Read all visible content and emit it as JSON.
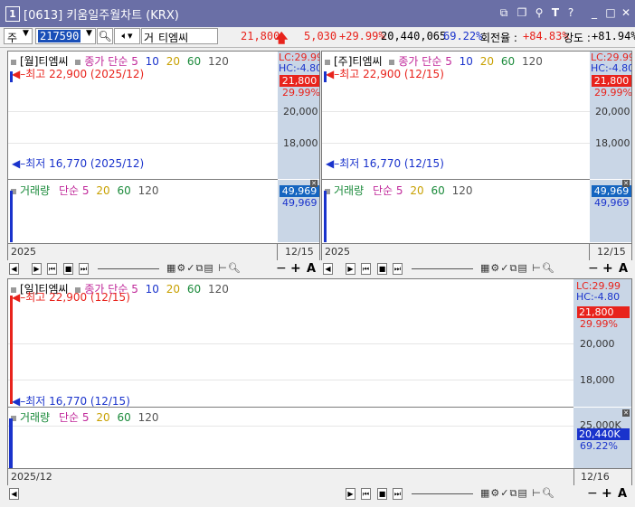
{
  "window": {
    "badge": "1",
    "title": "[0613] 키움일주월차트 (KRX)"
  },
  "toolbar": {
    "period_type": "주",
    "code": "217590",
    "market_flag": "거",
    "stock_name": "티엠씨",
    "price": "21,800",
    "change": "5,030",
    "change_pct": "+29.99%",
    "volume": "20,440,065",
    "volume_ratio": "69.22%",
    "turnover_label": "회전율 :",
    "turnover_value": "+84.83%",
    "strength_label": "강도 :",
    "strength_value": "+81.94%"
  },
  "panel_month": {
    "legend_title": "[월]티엠씨",
    "legend_price": "종가",
    "legend_ma_label": "단순",
    "ma_periods": [
      "5",
      "10",
      "20",
      "60",
      "120"
    ],
    "high_label": "최고 22,900 (2025/12)",
    "low_label": "최저 16,770 (2025/12)",
    "lc": "LC:29.99",
    "hc": "HC:-4.80",
    "price_badge": "21,800",
    "price_pct": "29.99%",
    "ticks": [
      "20,000",
      "18,000"
    ],
    "vol_legend": "거래량",
    "vol_badge": "49,969",
    "vol_value": "49,969",
    "x_start": "2025",
    "x_end": "12/15"
  },
  "panel_week": {
    "legend_title": "[주]티엠씨",
    "legend_price": "종가",
    "legend_ma_label": "단순",
    "ma_periods": [
      "5",
      "10",
      "20",
      "60",
      "120"
    ],
    "high_label": "최고 22,900 (12/15)",
    "low_label": "최저 16,770 (12/15)",
    "lc": "LC:29.99",
    "hc": "HC:-4.80",
    "price_badge": "21,800",
    "price_pct": "29.99%",
    "ticks": [
      "20,000",
      "18,000"
    ],
    "vol_legend": "거래량",
    "vol_badge": "49,969",
    "vol_value": "49,969",
    "x_start": "2025",
    "x_end": "12/15"
  },
  "panel_day": {
    "legend_title": "[일]티엠씨",
    "legend_price": "종가",
    "legend_ma_label": "단순",
    "ma_periods": [
      "5",
      "10",
      "20",
      "60",
      "120"
    ],
    "high_label": "최고 22,900 (12/15)",
    "low_label": "최저 16,770 (12/15)",
    "lc": "LC:29.99",
    "hc": "HC:-4.80",
    "price_badge": "21,800",
    "price_pct": "29.99%",
    "ticks": [
      "20,000",
      "18,000"
    ],
    "vol_legend": "거래량",
    "vol_tick": "25,000K",
    "vol_badge": "20,440K",
    "vol_pct": "69.22%",
    "x_start": "2025/12",
    "x_end": "12/16"
  },
  "nav": {
    "zoom_minus": "−",
    "zoom_plus": "+",
    "text_size": "A"
  },
  "colors": {
    "title_bar": "#6a6fa6",
    "up_red": "#e8231c",
    "down_blue": "#1a33cc",
    "ma5": "#c0289a",
    "ma10": "#1a33cc",
    "ma20": "#c8a000",
    "ma60": "#1a8a3a",
    "ma120": "#555555",
    "axis_bg": "#c9d6e6",
    "badge_blue": "#1565c0"
  }
}
